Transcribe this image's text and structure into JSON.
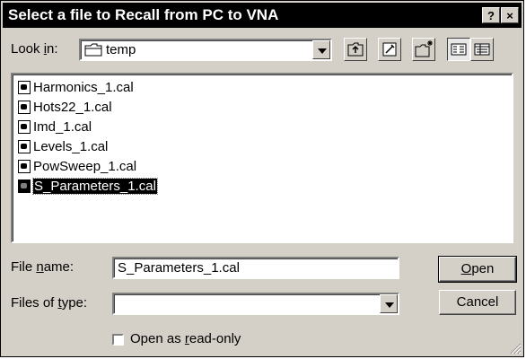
{
  "window": {
    "title": "Select a file to Recall from PC to VNA",
    "help_label": "?",
    "close_label": "×"
  },
  "look_in": {
    "label_pre": "Look ",
    "label_key": "i",
    "label_post": "n:",
    "value": "temp"
  },
  "files": [
    {
      "name": "Harmonics_1.cal",
      "selected": false
    },
    {
      "name": "Hots22_1.cal",
      "selected": false
    },
    {
      "name": "Imd_1.cal",
      "selected": false
    },
    {
      "name": "Levels_1.cal",
      "selected": false
    },
    {
      "name": "PowSweep_1.cal",
      "selected": false
    },
    {
      "name": "S_Parameters_1.cal",
      "selected": true
    }
  ],
  "file_name": {
    "label_pre": "File ",
    "label_key": "n",
    "label_post": "ame:",
    "value": "S_Parameters_1.cal"
  },
  "file_type": {
    "label_pre": "Files of ",
    "label_key": "t",
    "label_post": "ype:",
    "value": ""
  },
  "buttons": {
    "open_key": "O",
    "open_rest": "pen",
    "cancel": "Cancel"
  },
  "readonly": {
    "label_pre": "Open as ",
    "label_key": "r",
    "label_post": "ead-only",
    "checked": false
  }
}
